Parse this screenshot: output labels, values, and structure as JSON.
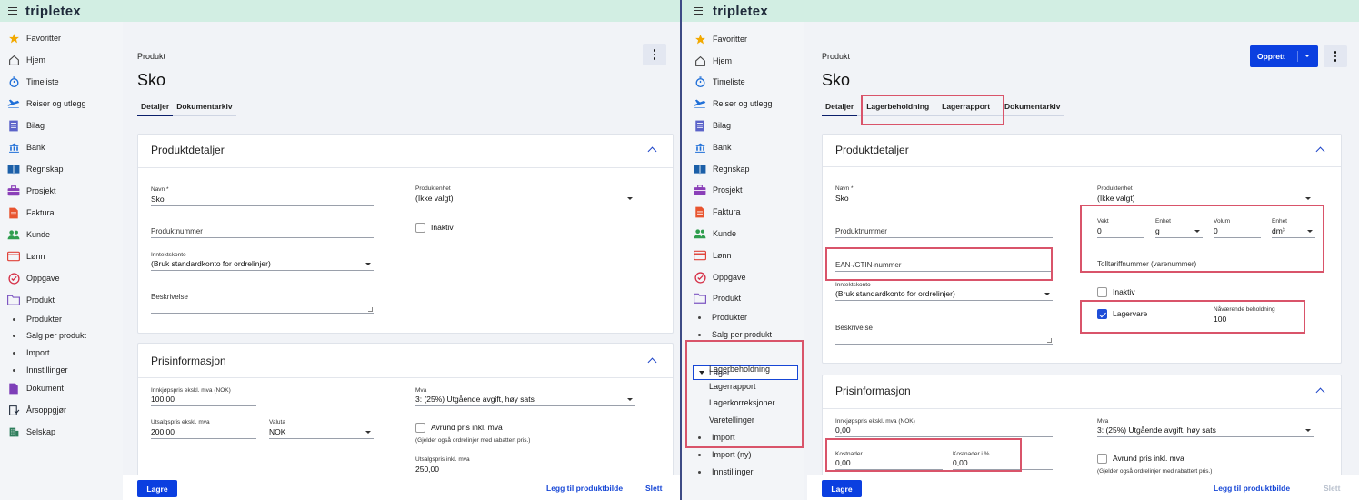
{
  "app": {
    "logo": "tripletex"
  },
  "sidebar": {
    "items": [
      {
        "label": "Favoritter",
        "icon": "star-icon"
      },
      {
        "label": "Hjem",
        "icon": "home-icon"
      },
      {
        "label": "Timeliste",
        "icon": "stopwatch-icon"
      },
      {
        "label": "Reiser og utlegg",
        "icon": "airplane-icon"
      },
      {
        "label": "Bilag",
        "icon": "receipt-icon"
      },
      {
        "label": "Bank",
        "icon": "bank-icon"
      },
      {
        "label": "Regnskap",
        "icon": "book-icon"
      },
      {
        "label": "Prosjekt",
        "icon": "briefcase-icon"
      },
      {
        "label": "Faktura",
        "icon": "invoice-icon"
      },
      {
        "label": "Kunde",
        "icon": "people-icon"
      },
      {
        "label": "Lønn",
        "icon": "wallet-icon"
      },
      {
        "label": "Oppgave",
        "icon": "check-circle-icon"
      },
      {
        "label": "Produkt",
        "icon": "folder-icon"
      }
    ],
    "produkt_sub_left": [
      "Produkter",
      "Salg per produkt",
      "Import",
      "Innstillinger"
    ],
    "bottom_left": [
      {
        "label": "Dokument",
        "icon": "document-icon"
      },
      {
        "label": "Årsoppgjør",
        "icon": "year-end-icon"
      },
      {
        "label": "Selskap",
        "icon": "company-icon"
      }
    ],
    "produkt_sub_right": [
      "Produkter",
      "Salg per produkt"
    ],
    "lager": {
      "label": "Lager",
      "children": [
        "Lagerbeholdning",
        "Lagerrapport",
        "Lagerkorreksjoner",
        "Varetellinger"
      ]
    },
    "produkt_sub_right_after": [
      "Import",
      "Import (ny)",
      "Innstillinger"
    ]
  },
  "page": {
    "breadcrumb": "Produkt",
    "title": "Sko",
    "tabs_left": [
      "Detaljer",
      "Dokumentarkiv"
    ],
    "tabs_right": [
      "Detaljer",
      "Lagerbeholdning",
      "Lagerrapport",
      "Dokumentarkiv"
    ],
    "create_label": "Opprett"
  },
  "details": {
    "section_title": "Produktdetaljer",
    "name_label": "Navn *",
    "name_value": "Sko",
    "product_number_placeholder": "Produktnummer",
    "ean_placeholder": "EAN-/GTIN-nummer",
    "income_account_label": "Inntektskonto",
    "income_account_value": "(Bruk standardkonto for ordrelinjer)",
    "description_placeholder": "Beskrivelse",
    "unit_label": "Produktenhet",
    "unit_value": "(Ikke valgt)",
    "inactive_label": "Inaktiv",
    "weight_label": "Vekt",
    "weight_value": "0",
    "weight_unit_label": "Enhet",
    "weight_unit_value": "g",
    "volume_label": "Volum",
    "volume_value": "0",
    "volume_unit_label": "Enhet",
    "volume_unit_value": "dm³",
    "customs_placeholder": "Tolltariffnummer (varenummer)",
    "stock_item_label": "Lagervare",
    "current_stock_label": "Nåværende beholdning",
    "current_stock_value": "100"
  },
  "pricing": {
    "section_title": "Prisinformasjon",
    "purchase_label": "Innkjøpspris ekskl. mva (NOK)",
    "purchase_value_left": "100,00",
    "purchase_value_right": "0,00",
    "sales_label": "Utsalgspris ekskl. mva",
    "sales_value": "200,00",
    "currency_label": "Valuta",
    "currency_value": "NOK",
    "vat_label": "Mva",
    "vat_value": "3: (25%) Utgående avgift, høy sats",
    "round_label": "Avrund pris inkl. mva",
    "round_hint": "(Gjelder også ordrelinjer med rabattert pris.)",
    "sales_incl_label": "Utsalgspris inkl. mva",
    "sales_incl_value": "250,00",
    "cost_label": "Kostnader",
    "cost_value": "0,00",
    "cost_pct_label": "Kostnader i %",
    "cost_pct_value": "0,00"
  },
  "footer": {
    "save_label": "Lagre",
    "add_image_label": "Legg til produktbilde",
    "delete_label": "Slett"
  },
  "colors": {
    "primary": "#0b3fe0",
    "highlight": "#d9546a",
    "topbar": "#d2eee3"
  }
}
